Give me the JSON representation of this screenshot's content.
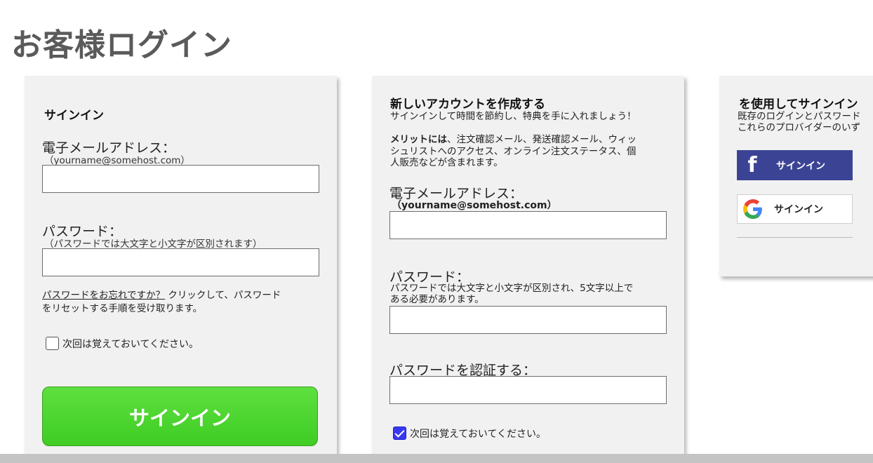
{
  "page_title": "お客様ログイン",
  "signin": {
    "heading": "サインイン",
    "email_label": "電子メールアドレス：",
    "email_hint": "（yourname@somehost.com）",
    "email_value": "",
    "password_label": "パスワード：",
    "password_hint": "（パスワードでは大文字と小文字が区別されます）",
    "password_value": "",
    "forgot_link": "パスワードをお忘れですか？",
    "forgot_text_1": "クリックして、パスワード",
    "forgot_text_2": "をリセットする手順を受け取ります。",
    "remember_label": "次回は覚えておいてください。",
    "remember_checked": false,
    "submit_label": "サインイン"
  },
  "create": {
    "heading": "新しいアカウントを作成する",
    "subheading": "サインインして時間を節約し、特典を手に入れましょう！",
    "benefits_bold": "メリットには",
    "benefits_line_1": "、注文確認メール、発送確認メール、ウィッ",
    "benefits_line_2": "シュリストへのアクセス、オンライン注文ステータス、個",
    "benefits_line_3": "人販売などが含まれます。",
    "email_label": "電子メールアドレス：",
    "email_hint": "（yourname@somehost.com）",
    "email_value": "",
    "password_label": "パスワード：",
    "password_hint_1": "パスワードでは大文字と小文字が区別され、5文字以上で",
    "password_hint_2": "ある必要があります。",
    "password_value": "",
    "confirm_label": "パスワードを認証する：",
    "confirm_value": "",
    "remember_label": "次回は覚えておいてください。",
    "remember_checked": true
  },
  "social": {
    "heading": "を使用してサインイン",
    "desc_line_1": "既存のログインとパスワード",
    "desc_line_2": "これらのプロバイダーのいず",
    "facebook_label": "サインイン",
    "google_label": "サインイン",
    "facebook_icon": "facebook-icon",
    "google_icon": "google-icon"
  },
  "colors": {
    "facebook": "#3b4494",
    "signin_button": "#4fd830",
    "checkbox_checked": "#3838f0",
    "title": "#5a5a5a",
    "panel_bg": "#f1f1f1"
  }
}
